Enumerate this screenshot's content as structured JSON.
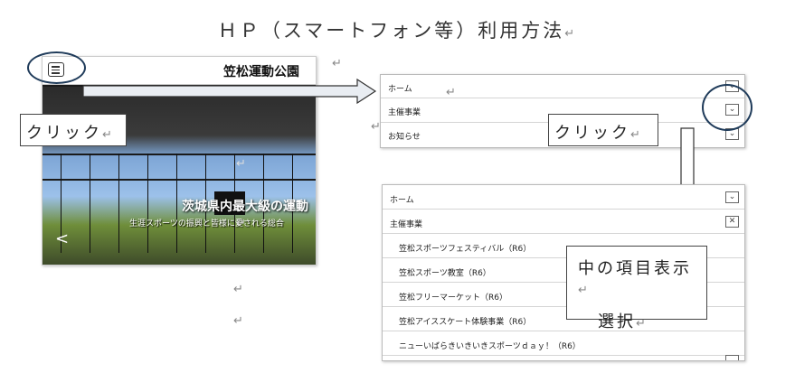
{
  "page_title": "ＨＰ（スマートフォン等）利用方法",
  "return_mark": "↵",
  "phone": {
    "site_title": "笠松運動公園",
    "hero_heading": "茨城県内最大級の運動",
    "hero_sub": "生涯スポーツの振興と皆様に愛される総合",
    "prev_glyph": "<"
  },
  "callouts": {
    "click_left": "クリック",
    "click_right": "クリック",
    "inner_items": "中の項目表示",
    "select": "選択"
  },
  "menu_top": [
    {
      "label": "ホーム",
      "icon": "chevron-down-icon"
    },
    {
      "label": "主催事業",
      "icon": "chevron-down-icon"
    },
    {
      "label": "お知らせ",
      "icon": "chevron-down-icon"
    }
  ],
  "menu_bottom": {
    "items": [
      {
        "label": "ホーム",
        "icon": "chevron-down-icon"
      },
      {
        "label": "主催事業",
        "icon": "close-icon"
      }
    ],
    "sub_items": [
      "笠松スポーツフェスティバル（R6）",
      "笠松スポーツ教室（R6）",
      "笠松フリーマーケット（R6）",
      "笠松アイススケート体験事業（R6）",
      "ニューいばらきいきいきスポーツｄａｙ！（R6）"
    ]
  }
}
